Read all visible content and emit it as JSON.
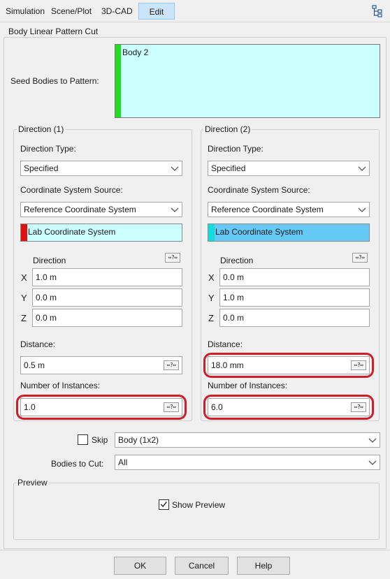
{
  "menu": {
    "items": [
      {
        "label": "Simulation"
      },
      {
        "label": "Scene/Plot"
      },
      {
        "label": "3D-CAD"
      },
      {
        "label": "Edit"
      }
    ]
  },
  "title": "Body Linear Pattern Cut",
  "seed": {
    "label": "Seed Bodies to Pattern:",
    "value": "Body 2",
    "bar_color": "#22dd22"
  },
  "direction1": {
    "title": "Direction (1)",
    "direction_type_label": "Direction Type:",
    "direction_type": "Specified",
    "coord_source_label": "Coordinate System Source:",
    "coord_source": "Reference Coordinate System",
    "coord_system": "Lab Coordinate System",
    "coord_bar_color": "#e01010",
    "coord_bg_color": "#ccffff",
    "direction_label": "Direction",
    "x_label": "X",
    "x_value": "1.0 m",
    "y_label": "Y",
    "y_value": "0.0 m",
    "z_label": "Z",
    "z_value": "0.0 m",
    "distance_label": "Distance:",
    "distance": "0.5 m",
    "instances_label": "Number of Instances:",
    "instances": "1.0"
  },
  "direction2": {
    "title": "Direction (2)",
    "direction_type_label": "Direction Type:",
    "direction_type": "Specified",
    "coord_source_label": "Coordinate System Source:",
    "coord_source": "Reference Coordinate System",
    "coord_system": "Lab Coordinate System",
    "coord_bar_color": "#11dddd",
    "coord_bg_color": "#66c8f5",
    "direction_label": "Direction",
    "x_label": "X",
    "x_value": "0.0 m",
    "y_label": "Y",
    "y_value": "1.0 m",
    "z_label": "Z",
    "z_value": "0.0 m",
    "distance_label": "Distance:",
    "distance": "18.0 mm",
    "instances_label": "Number of Instances:",
    "instances": "6.0"
  },
  "unit_button_label": "⇔?⇔",
  "skip": {
    "label": "Skip",
    "checked": false,
    "value": "Body (1x2)"
  },
  "bodies_to_cut": {
    "label": "Bodies to Cut:",
    "value": "All"
  },
  "preview": {
    "title": "Preview",
    "show_label": "Show Preview",
    "checked": true
  },
  "buttons": {
    "ok": "OK",
    "cancel": "Cancel",
    "help": "Help"
  },
  "colors": {
    "highlight": "#cc1f2a",
    "active_tab": "#cce4f7"
  }
}
